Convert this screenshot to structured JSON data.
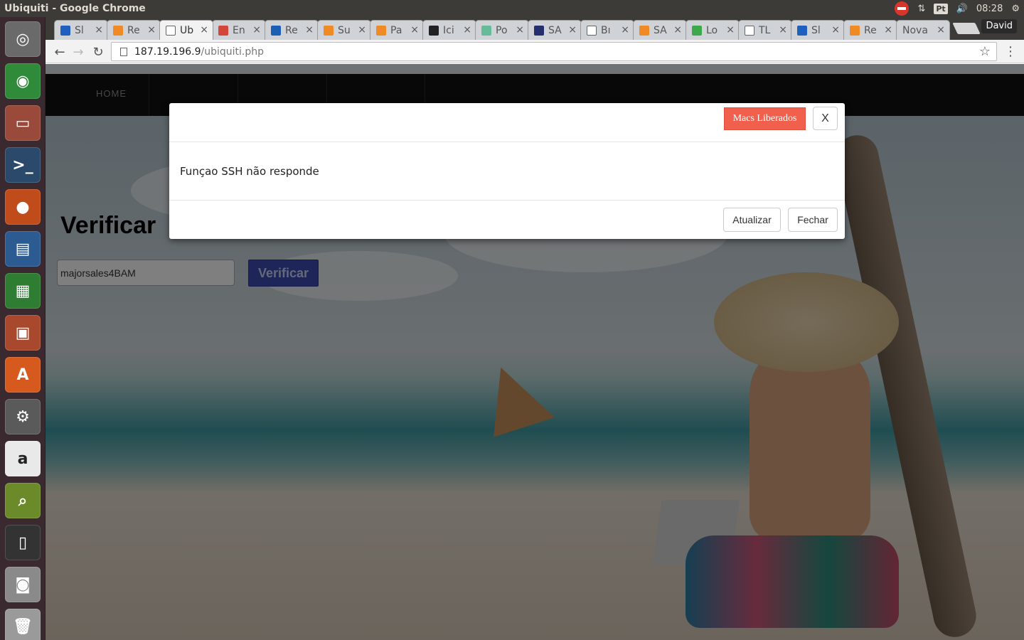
{
  "window_title": "Ubiquiti - Google Chrome",
  "panel": {
    "keyboard_layout": "Pt",
    "clock": "08:28",
    "icons": [
      "no-entry-icon",
      "network-transfer-icon",
      "keyboard-layout-icon",
      "volume-icon",
      "gear-icon"
    ]
  },
  "launcher": {
    "items": [
      {
        "name": "dash-icon",
        "glyph": "◎",
        "color": "#6a6a6a"
      },
      {
        "name": "chrome-icon",
        "glyph": "◉",
        "color": "#2f8b3a"
      },
      {
        "name": "files-icon",
        "glyph": "▭",
        "color": "#9a4a3a"
      },
      {
        "name": "terminal-icon",
        "glyph": ">_",
        "color": "#2b4a6b"
      },
      {
        "name": "firefox-icon",
        "glyph": "●",
        "color": "#c04c1c"
      },
      {
        "name": "writer-icon",
        "glyph": "▤",
        "color": "#2c5b92"
      },
      {
        "name": "calc-icon",
        "glyph": "▦",
        "color": "#2e7d32"
      },
      {
        "name": "impress-icon",
        "glyph": "▣",
        "color": "#a8482c"
      },
      {
        "name": "software-center-icon",
        "glyph": "A",
        "color": "#d65a1d"
      },
      {
        "name": "system-settings-icon",
        "glyph": "⚙",
        "color": "#5a5a5a"
      },
      {
        "name": "amazon-icon",
        "glyph": "a",
        "color": "#e9e9e9"
      },
      {
        "name": "image-viewer-icon",
        "glyph": "⌕",
        "color": "#6b8a2a"
      },
      {
        "name": "phone-icon",
        "glyph": "▯",
        "color": "#333333"
      },
      {
        "name": "camera-icon",
        "glyph": "◙",
        "color": "#8a8a8a"
      },
      {
        "name": "trash-icon",
        "glyph": "🗑",
        "color": "#9a9a9a"
      }
    ]
  },
  "browser": {
    "profile": "David",
    "tabs": [
      {
        "label": "Sl",
        "fav": "#1f5fbf"
      },
      {
        "label": "Re",
        "fav": "#f08a24"
      },
      {
        "label": "Ub",
        "fav": "#ffffff",
        "active": true
      },
      {
        "label": "En",
        "fav": "#d44638"
      },
      {
        "label": "Re",
        "fav": "#1c5fb5"
      },
      {
        "label": "Su",
        "fav": "#f08a24"
      },
      {
        "label": "Pa",
        "fav": "#f08a24"
      },
      {
        "label": "Ici",
        "fav": "#222222"
      },
      {
        "label": "Po",
        "fav": "#66bb99"
      },
      {
        "label": "SA",
        "fav": "#23306d"
      },
      {
        "label": "Bı",
        "fav": "#ffffff"
      },
      {
        "label": "SA",
        "fav": "#f08a24"
      },
      {
        "label": "Lo",
        "fav": "#3da94a"
      },
      {
        "label": "TL",
        "fav": "#ffffff"
      },
      {
        "label": "Sl",
        "fav": "#1f5fbf"
      },
      {
        "label": "Re",
        "fav": "#f08a24"
      },
      {
        "label": "Nova",
        "fav": ""
      }
    ],
    "url_host": "187.19.196.9",
    "url_path": "/ubiquiti.php"
  },
  "site": {
    "nav_home": "HOME",
    "heading": "Verificar",
    "mac_input_value": "majorsales4BAM",
    "verify_button": "Verificar"
  },
  "modal": {
    "macs_button": "Macs Liberados",
    "close_x": "X",
    "message": "Funçao SSH não responde",
    "refresh_button": "Atualizar",
    "close_button": "Fechar",
    "accent_color": "#f1604d"
  }
}
